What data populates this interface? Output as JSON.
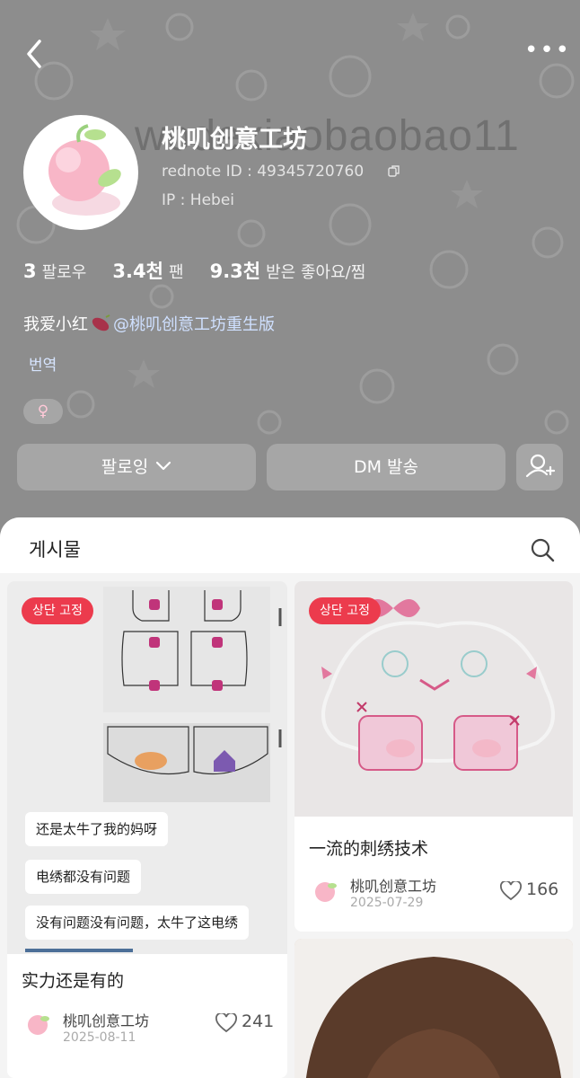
{
  "profile": {
    "nickname": "桃叽创意工坊",
    "background_text": "wodexiaobaobao11",
    "rednote_id": "rednote ID : 49345720760",
    "ip": "IP : Hebei",
    "stats": [
      {
        "value": "3",
        "label": "팔로우"
      },
      {
        "value": "3.4천",
        "label": "팬"
      },
      {
        "value": "9.3천",
        "label": "받은 좋아요/찜"
      }
    ],
    "bio_text": "我爱小红",
    "bio_mention": "@桃叽创意工坊重生版",
    "translate_label": "번역",
    "gender_symbol": "♀"
  },
  "actions": {
    "follow_label": "팔로잉",
    "dm_label": "DM 발송"
  },
  "feed": {
    "tab_label": "게시물",
    "posts": [
      {
        "pin_label": "상단 고정",
        "chat_lines": [
          "还是太牛了我的妈呀",
          "电绣都没有问题",
          "没有问题没有问题，太牛了这电绣"
        ],
        "title": "实力还是有的",
        "author": "桃叽创意工坊",
        "date": "2025-08-11",
        "likes": "241"
      },
      {
        "pin_label": "상단 고정",
        "title": "一流的刺绣技术",
        "author": "桃叽创意工坊",
        "date": "2025-07-29",
        "likes": "166"
      }
    ]
  },
  "colors": {
    "accent_red": "#ec3b4d",
    "link_blue": "#cfe0ff"
  }
}
